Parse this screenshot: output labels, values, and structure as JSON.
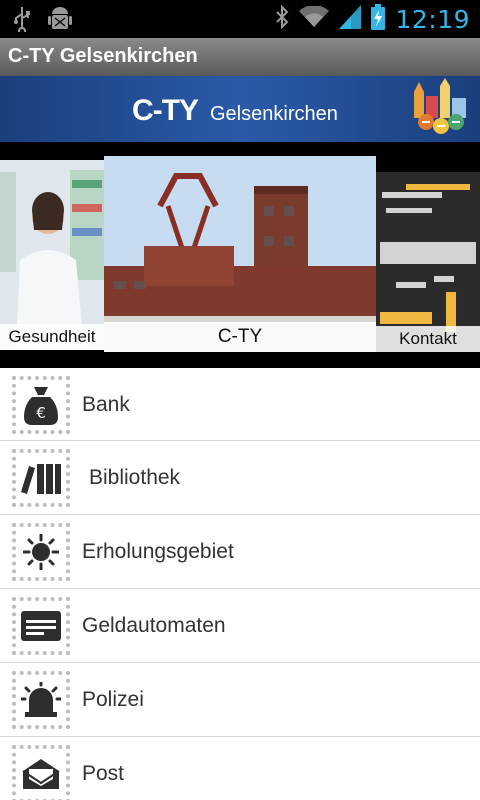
{
  "status_bar": {
    "time": "12:19",
    "icons": [
      "usb-icon",
      "android-debug-icon",
      "bluetooth-icon",
      "wifi-icon",
      "signal-icon",
      "battery-charging-icon"
    ]
  },
  "app_bar": {
    "title": "C-TY Gelsenkirchen"
  },
  "banner": {
    "brand": "C-TY",
    "brand_sub": "Gelsenkirchen"
  },
  "carousel": {
    "items": [
      {
        "caption": "Gesundheit"
      },
      {
        "caption": "C-TY"
      },
      {
        "caption": "Kontakt"
      }
    ]
  },
  "menu": {
    "items": [
      {
        "label": "Bank",
        "icon": "money-bag-icon"
      },
      {
        "label": "Bibliothek",
        "icon": "books-icon"
      },
      {
        "label": "Erholungsgebiet",
        "icon": "sun-icon"
      },
      {
        "label": "Geldautomaten",
        "icon": "card-icon"
      },
      {
        "label": "Polizei",
        "icon": "siren-icon"
      },
      {
        "label": "Post",
        "icon": "mail-icon"
      }
    ]
  },
  "colors": {
    "accent_time": "#33b5e5",
    "banner_blue": "#1b3f7d"
  }
}
